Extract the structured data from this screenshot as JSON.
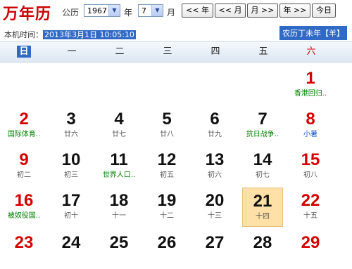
{
  "app": {
    "title": "万年历"
  },
  "toolbar": {
    "calendar_label": "公历",
    "year_value": "1967",
    "year_suffix": "年",
    "month_value": "7",
    "month_suffix": "月",
    "prev_year_label": "<< 年",
    "prev_month_label": "<< 月",
    "next_month_label": "月 >>",
    "next_year_label": "年 >>",
    "today_label": "今日"
  },
  "info": {
    "local_time_label": "本机时间：",
    "local_time_value": "2013年3月1日 10:05:10",
    "lunar_header": "农历丁未年【羊】"
  },
  "weekdays": [
    "日",
    "一",
    "二",
    "三",
    "四",
    "五",
    "六"
  ],
  "weeks": [
    [
      null,
      null,
      null,
      null,
      null,
      null,
      {
        "day": "1",
        "lunar": "香港回归..",
        "red": true,
        "lunar_style": "fest"
      }
    ],
    [
      {
        "day": "2",
        "lunar": "国际体育..",
        "red": true,
        "lunar_style": "fest"
      },
      {
        "day": "3",
        "lunar": "廿六"
      },
      {
        "day": "4",
        "lunar": "廿七"
      },
      {
        "day": "5",
        "lunar": "廿八"
      },
      {
        "day": "6",
        "lunar": "廿九"
      },
      {
        "day": "7",
        "lunar": "抗日战争..",
        "lunar_style": "fest"
      },
      {
        "day": "8",
        "lunar": "小暑",
        "red": true,
        "lunar_style": "term"
      }
    ],
    [
      {
        "day": "9",
        "lunar": "初二",
        "red": true
      },
      {
        "day": "10",
        "lunar": "初三"
      },
      {
        "day": "11",
        "lunar": "世界人口..",
        "lunar_style": "fest"
      },
      {
        "day": "12",
        "lunar": "初五"
      },
      {
        "day": "13",
        "lunar": "初六"
      },
      {
        "day": "14",
        "lunar": "初七"
      },
      {
        "day": "15",
        "lunar": "初八",
        "red": true
      }
    ],
    [
      {
        "day": "16",
        "lunar": "被奴役国..",
        "red": true,
        "lunar_style": "fest"
      },
      {
        "day": "17",
        "lunar": "初十"
      },
      {
        "day": "18",
        "lunar": "十一"
      },
      {
        "day": "19",
        "lunar": "十二"
      },
      {
        "day": "20",
        "lunar": "十三"
      },
      {
        "day": "21",
        "lunar": "十四",
        "today": true
      },
      {
        "day": "22",
        "lunar": "十五",
        "red": true
      }
    ],
    [
      {
        "day": "23",
        "lunar": "",
        "red": true
      },
      {
        "day": "24",
        "lunar": ""
      },
      {
        "day": "25",
        "lunar": ""
      },
      {
        "day": "26",
        "lunar": ""
      },
      {
        "day": "27",
        "lunar": ""
      },
      {
        "day": "28",
        "lunar": ""
      },
      {
        "day": "29",
        "lunar": "",
        "red": true
      }
    ]
  ]
}
